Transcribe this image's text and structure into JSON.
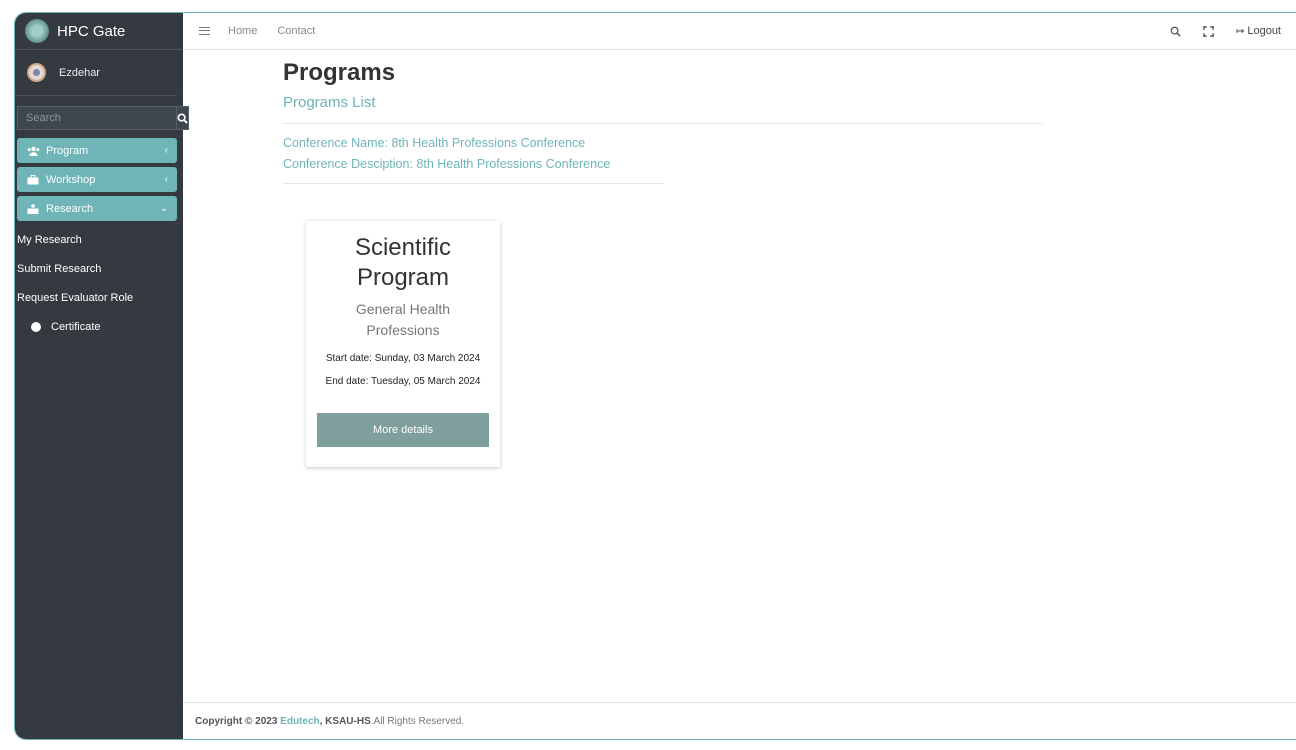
{
  "app": {
    "brand": "HPC Gate"
  },
  "user": {
    "name": "Ezdehar"
  },
  "search": {
    "placeholder": "Search"
  },
  "sidebar": {
    "items": [
      {
        "label": "Program",
        "icon": "users-icon"
      },
      {
        "label": "Workshop",
        "icon": "briefcase-icon"
      },
      {
        "label": "Research",
        "icon": "person-board-icon"
      }
    ],
    "sub_items": [
      "My Research",
      "Submit Research",
      "Request Evaluator Role"
    ],
    "certificate": "Certificate"
  },
  "topbar": {
    "home": "Home",
    "contact": "Contact",
    "logout": "Logout"
  },
  "page": {
    "title": "Programs",
    "subtitle": "Programs List",
    "conference_name": "Conference Name: 8th Health Professions Conference",
    "conference_description": "Conference Desciption: 8th Health Professions Conference"
  },
  "card": {
    "title": "Scientific Program",
    "subtitle": "General Health Professions",
    "start_date": "Start date: Sunday, 03 March 2024",
    "end_date": "End date: Tuesday, 05 March 2024",
    "button": "More details"
  },
  "footer": {
    "prefix": "Copyright © 2023",
    "company": "Edutech",
    "org": ", KSAU-HS",
    "rights": ".All Rights Reserved."
  },
  "colors": {
    "accent": "#6fb5b8",
    "sidebar": "#343a40",
    "button": "#7f9f9c"
  }
}
